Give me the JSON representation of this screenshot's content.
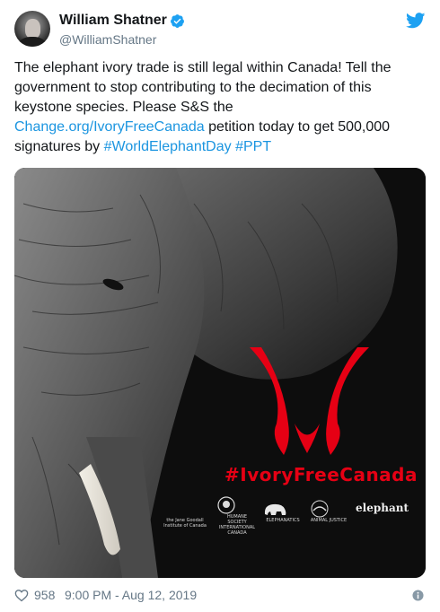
{
  "author": {
    "name": "William Shatner",
    "handle": "@WilliamShatner",
    "verified": true
  },
  "tweet": {
    "text_part1": "The elephant ivory trade is still legal within Canada! Tell the government to stop contributing to the decimation of this keystone species. Please S&S the ",
    "link": "Change.org/IvoryFreeCanada",
    "text_part2": " petition today to get 500,000 signatures by ",
    "hashtag1": "#WorldElephantDay",
    "space": " ",
    "hashtag2": "#PPT"
  },
  "media": {
    "hashtag_text": "#IvoryFreeCanada",
    "logos": [
      {
        "icon": "jane-goodall-logo",
        "label": "the Jane Goodall Institute of Canada"
      },
      {
        "icon": "humane-society-logo",
        "label": "HUMANE SOCIETY INTERNATIONAL CANADA"
      },
      {
        "icon": "elephanatics-logo",
        "label": "ELEPHANATICS"
      },
      {
        "icon": "animal-justice-logo",
        "label": "ANIMAL JUSTICE"
      },
      {
        "icon": "elephant-fund-logo",
        "label": "elephant"
      }
    ]
  },
  "footer": {
    "likes": "958",
    "timestamp": "9:00 PM - Aug 12, 2019"
  },
  "colors": {
    "link": "#1b95e0",
    "twitter_blue": "#1da1f2",
    "ribbon_red": "#e60014",
    "secondary_text": "#657786"
  }
}
